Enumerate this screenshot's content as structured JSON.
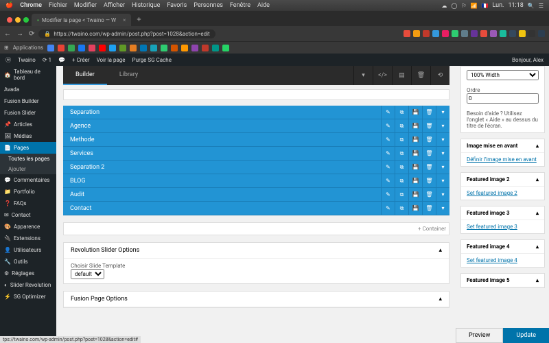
{
  "menubar": {
    "app": "Chrome",
    "items": [
      "Fichier",
      "Modifier",
      "Afficher",
      "Historique",
      "Favoris",
      "Personnes",
      "Fenêtre",
      "Aide"
    ],
    "day": "Lun.",
    "time": "11:18"
  },
  "tab": {
    "title": "Modifier la page < Twaino — W"
  },
  "url": "https://twaino.com/wp-admin/post.php?post=1028&action=edit",
  "bookmarks": {
    "apps": "Applications"
  },
  "wpbar": {
    "site": "Twaino",
    "comments": "1",
    "new": "+ Créer",
    "view": "Voir la page",
    "purge": "Purge SG Cache",
    "greeting": "Bonjour, Alex"
  },
  "sidebar": {
    "items": [
      "Tableau de bord",
      "Avada",
      "Fusion Builder",
      "Fusion Slider",
      "Articles",
      "Médias",
      "Pages",
      "Commentaires",
      "Portfolio",
      "FAQs",
      "Contact",
      "Apparence",
      "Extensions",
      "Utilisateurs",
      "Outils",
      "Réglages",
      "Slider Revolution",
      "SG Optimizer"
    ],
    "subs": [
      "Toutes les pages",
      "Ajouter"
    ]
  },
  "builder": {
    "tabs": [
      "Builder",
      "Library"
    ],
    "rows": [
      "Separation",
      "Agence",
      "Methode",
      "Services",
      "Separation 2",
      "BLOG",
      "Audit",
      "Contact"
    ],
    "addContainer": "+ Container"
  },
  "panels": {
    "rev": {
      "title": "Revolution Slider Options",
      "label": "Choisir Slide Template",
      "value": "default"
    },
    "fusion": {
      "title": "Fusion Page Options"
    }
  },
  "rside": {
    "width": {
      "value": "100% Width"
    },
    "order": {
      "label": "Ordre",
      "value": "0"
    },
    "help": "Besoin d'aide ? Utilisez l'onglet « Aide » au dessus du titre de l'écran.",
    "featured": {
      "title": "Image mise en avant",
      "link": "Définir l'image mise en avant"
    },
    "f2": {
      "title": "Featured image 2",
      "link": "Set featured image 2"
    },
    "f3": {
      "title": "Featured image 3",
      "link": "Set featured image 3"
    },
    "f4": {
      "title": "Featured image 4",
      "link": "Set featured image 4"
    },
    "f5": {
      "title": "Featured image 5"
    }
  },
  "footer": {
    "preview": "Preview",
    "update": "Update"
  },
  "status": "tps://twaino.com/wp-admin/post.php?post=1028&action=edit#"
}
